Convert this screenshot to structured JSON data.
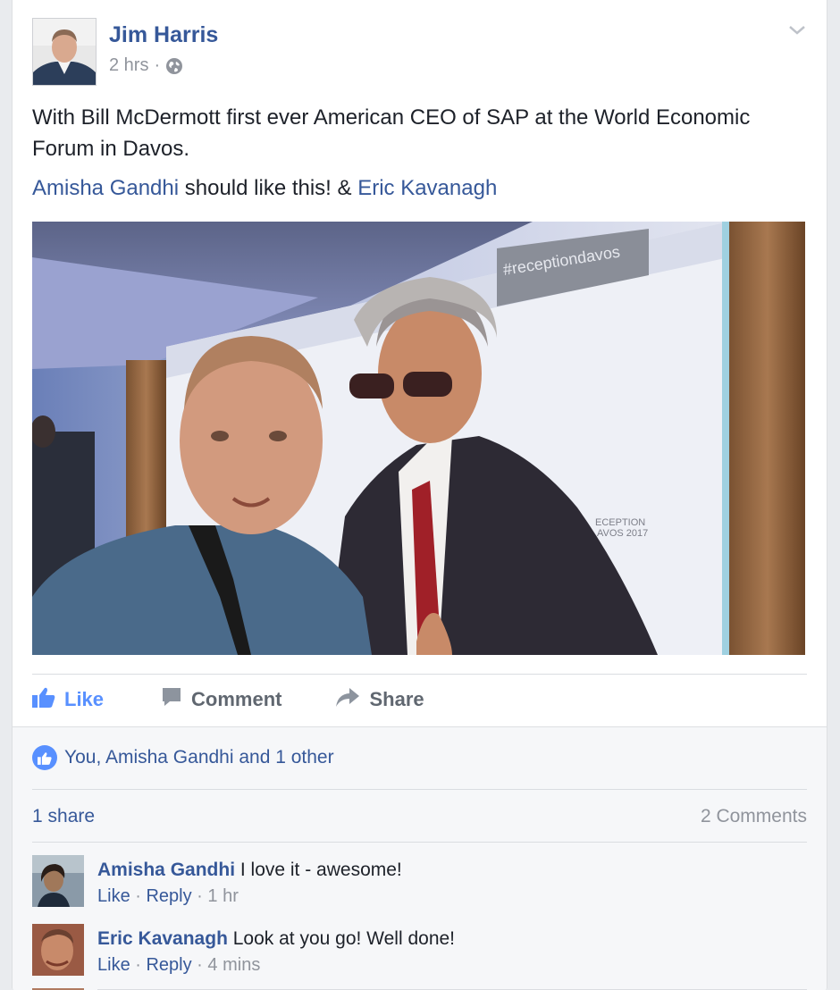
{
  "post": {
    "author": "Jim Harris",
    "time": "2 hrs",
    "separator": "·",
    "privacy_icon": "globe-icon",
    "options_icon": "chevron-down-icon",
    "text": "With Bill McDermott first ever American CEO of SAP at the World Economic Forum in Davos.",
    "mention1": "Amisha Gandhi",
    "mention_mid": " should like this! & ",
    "mention2": "Eric Kavanagh",
    "photo_banner": "#receptiondavos",
    "photo_backdrop_text": "ECEPTION\nVOS 2017"
  },
  "actions": {
    "like": "Like",
    "comment": "Comment",
    "share": "Share"
  },
  "reactions": {
    "likes_text": "You, Amisha Gandhi and 1 other",
    "shares": "1 share",
    "comments_count": "2 Comments"
  },
  "comments": [
    {
      "name": "Amisha Gandhi",
      "text": " I love it - awesome!",
      "like": "Like",
      "reply": "Reply",
      "sep": " · ",
      "time": "1 hr"
    },
    {
      "name": "Eric Kavanagh",
      "text": " Look at you go! Well done!",
      "like": "Like",
      "reply": "Reply",
      "sep": " · ",
      "time": "4 mins"
    }
  ],
  "colors": {
    "link": "#365899",
    "like_active": "#5890ff",
    "muted": "#90949c",
    "footer_bg": "#f6f7f9"
  }
}
